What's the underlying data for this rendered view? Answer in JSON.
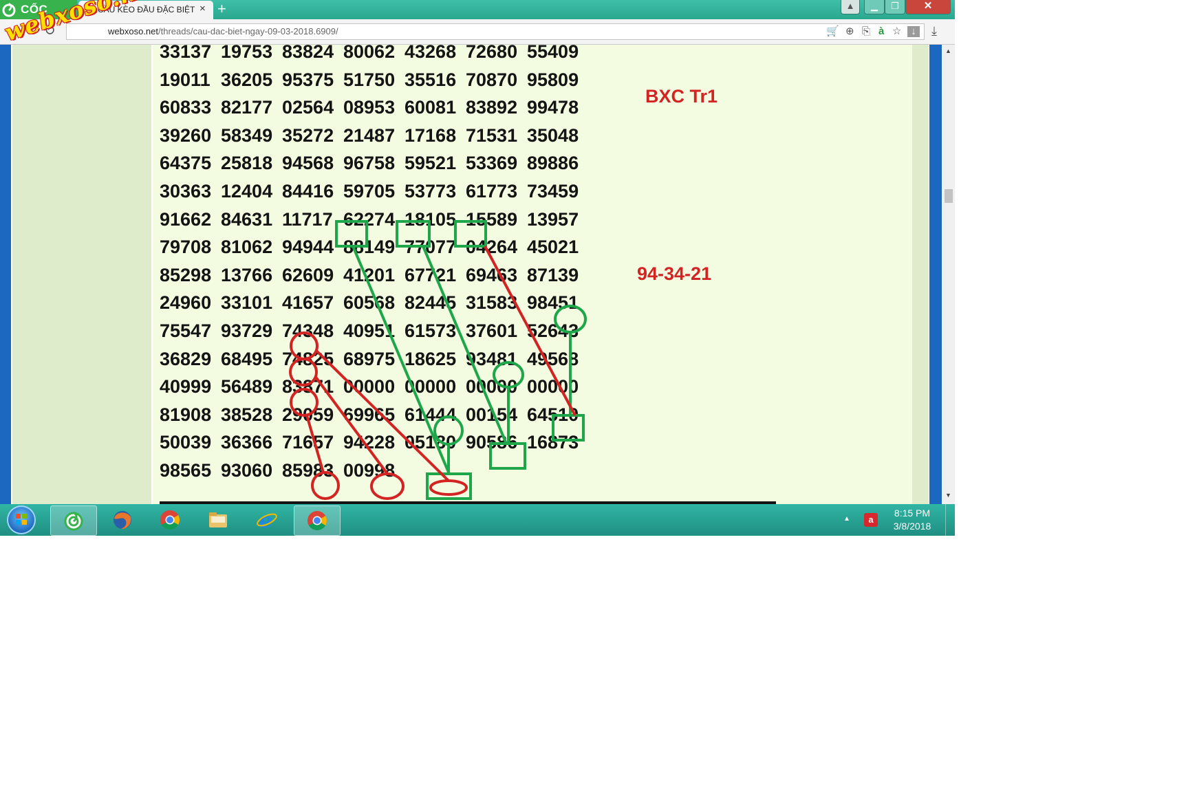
{
  "browser": {
    "brand": "CỐC CỐC",
    "tab_title": "CẦU KÈO ĐẦU ĐẶC BIỆT",
    "tab_favicon": "XS",
    "url_prefix": "webxoso.net",
    "url_path": "/threads/cau-dac-biet-ngay-09-03-2018.6909/"
  },
  "watermark": "webxoso.net",
  "page": {
    "rows": [
      [
        "33137",
        "19753",
        "83824",
        "80062",
        "43268",
        "72680",
        "55409"
      ],
      [
        "19011",
        "36205",
        "95375",
        "51750",
        "35516",
        "70870",
        "95809"
      ],
      [
        "60833",
        "82177",
        "02564",
        "08953",
        "60081",
        "83892",
        "99478"
      ],
      [
        "39260",
        "58349",
        "35272",
        "21487",
        "17168",
        "71531",
        "35048"
      ],
      [
        "64375",
        "25818",
        "94568",
        "96758",
        "59521",
        "53369",
        "89886"
      ],
      [
        "30363",
        "12404",
        "84416",
        "59705",
        "53773",
        "61773",
        "73459"
      ],
      [
        "91662",
        "84631",
        "11717",
        "62274",
        "18105",
        "15589",
        "13957"
      ],
      [
        "79708",
        "81062",
        "94944",
        "88149",
        "77077",
        "04264",
        "45021"
      ],
      [
        "85298",
        "13766",
        "62609",
        "41201",
        "67721",
        "69463",
        "87139"
      ],
      [
        "24960",
        "33101",
        "41657",
        "60568",
        "82445",
        "31583",
        "98451"
      ],
      [
        "75547",
        "93729",
        "74348",
        "40951",
        "61573",
        "37601",
        "52643"
      ],
      [
        "36829",
        "68495",
        "74825",
        "68975",
        "18625",
        "93481",
        "49568"
      ],
      [
        "40999",
        "56489",
        "83871",
        "00000",
        "00000",
        "00000",
        "00000"
      ],
      [
        "81908",
        "38528",
        "29059",
        "69965",
        "61444",
        "00154",
        "64510"
      ],
      [
        "50039",
        "36366",
        "71657",
        "94228",
        "05180",
        "90586",
        "16873"
      ],
      [
        "98565",
        "93060",
        "85983",
        "00998",
        "",
        "",
        ""
      ]
    ],
    "note1": "BXC Tr1",
    "note2": "94-34-21",
    "annotation_colors": {
      "green": "#1fa64a",
      "red": "#d32424"
    }
  },
  "taskbar": {
    "time": "8:15 PM",
    "date": "3/8/2018",
    "apps": [
      "coccoc-icon",
      "firefox-icon",
      "chrome-icon",
      "folder-icon",
      "ie-icon",
      "chrome-icon"
    ]
  }
}
